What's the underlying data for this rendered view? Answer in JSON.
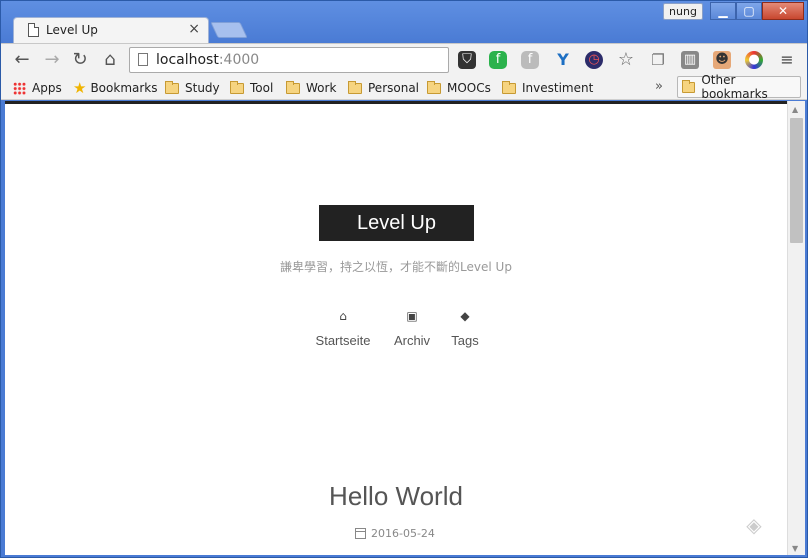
{
  "window": {
    "tab_title": "Level Up",
    "tab_close": "×",
    "user": "nung",
    "min_glyph": "▁",
    "max_glyph": "▢",
    "close_glyph": "✕"
  },
  "toolbar": {
    "back": "←",
    "forward": "→",
    "reload": "↻",
    "home": "⌂",
    "url_host": "localhost",
    "url_port": ":4000",
    "ext_pocket": "⛉",
    "ext_feedly": "f",
    "ext_feedly2": "f",
    "ext_y": "Y",
    "ext_speed": "◷",
    "star": "☆",
    "copy": "❐",
    "trello": "▥",
    "face": "☻",
    "color": "●",
    "menu": "≡"
  },
  "bookmarks": {
    "apps": "Apps",
    "bookmarks": "Bookmarks",
    "folders": [
      "Study",
      "Tool",
      "Work",
      "Personal",
      "MOOCs",
      "Investiment"
    ],
    "more": "»",
    "other": "Other bookmarks"
  },
  "page": {
    "site_title": "Level Up",
    "tagline": "謙卑學習，持之以恆，才能不斷的Level Up",
    "nav": [
      {
        "icon": "home-icon",
        "glyph": "⌂",
        "label": "Startseite"
      },
      {
        "icon": "archive-icon",
        "glyph": "▣",
        "label": "Archiv"
      },
      {
        "icon": "tags-icon",
        "glyph": "◆",
        "label": "Tags"
      }
    ],
    "post": {
      "title": "Hello World",
      "date": "2016-05-24"
    },
    "feedly_glyph": "◈"
  },
  "scrollbar": {
    "up": "▲",
    "down": "▼"
  }
}
